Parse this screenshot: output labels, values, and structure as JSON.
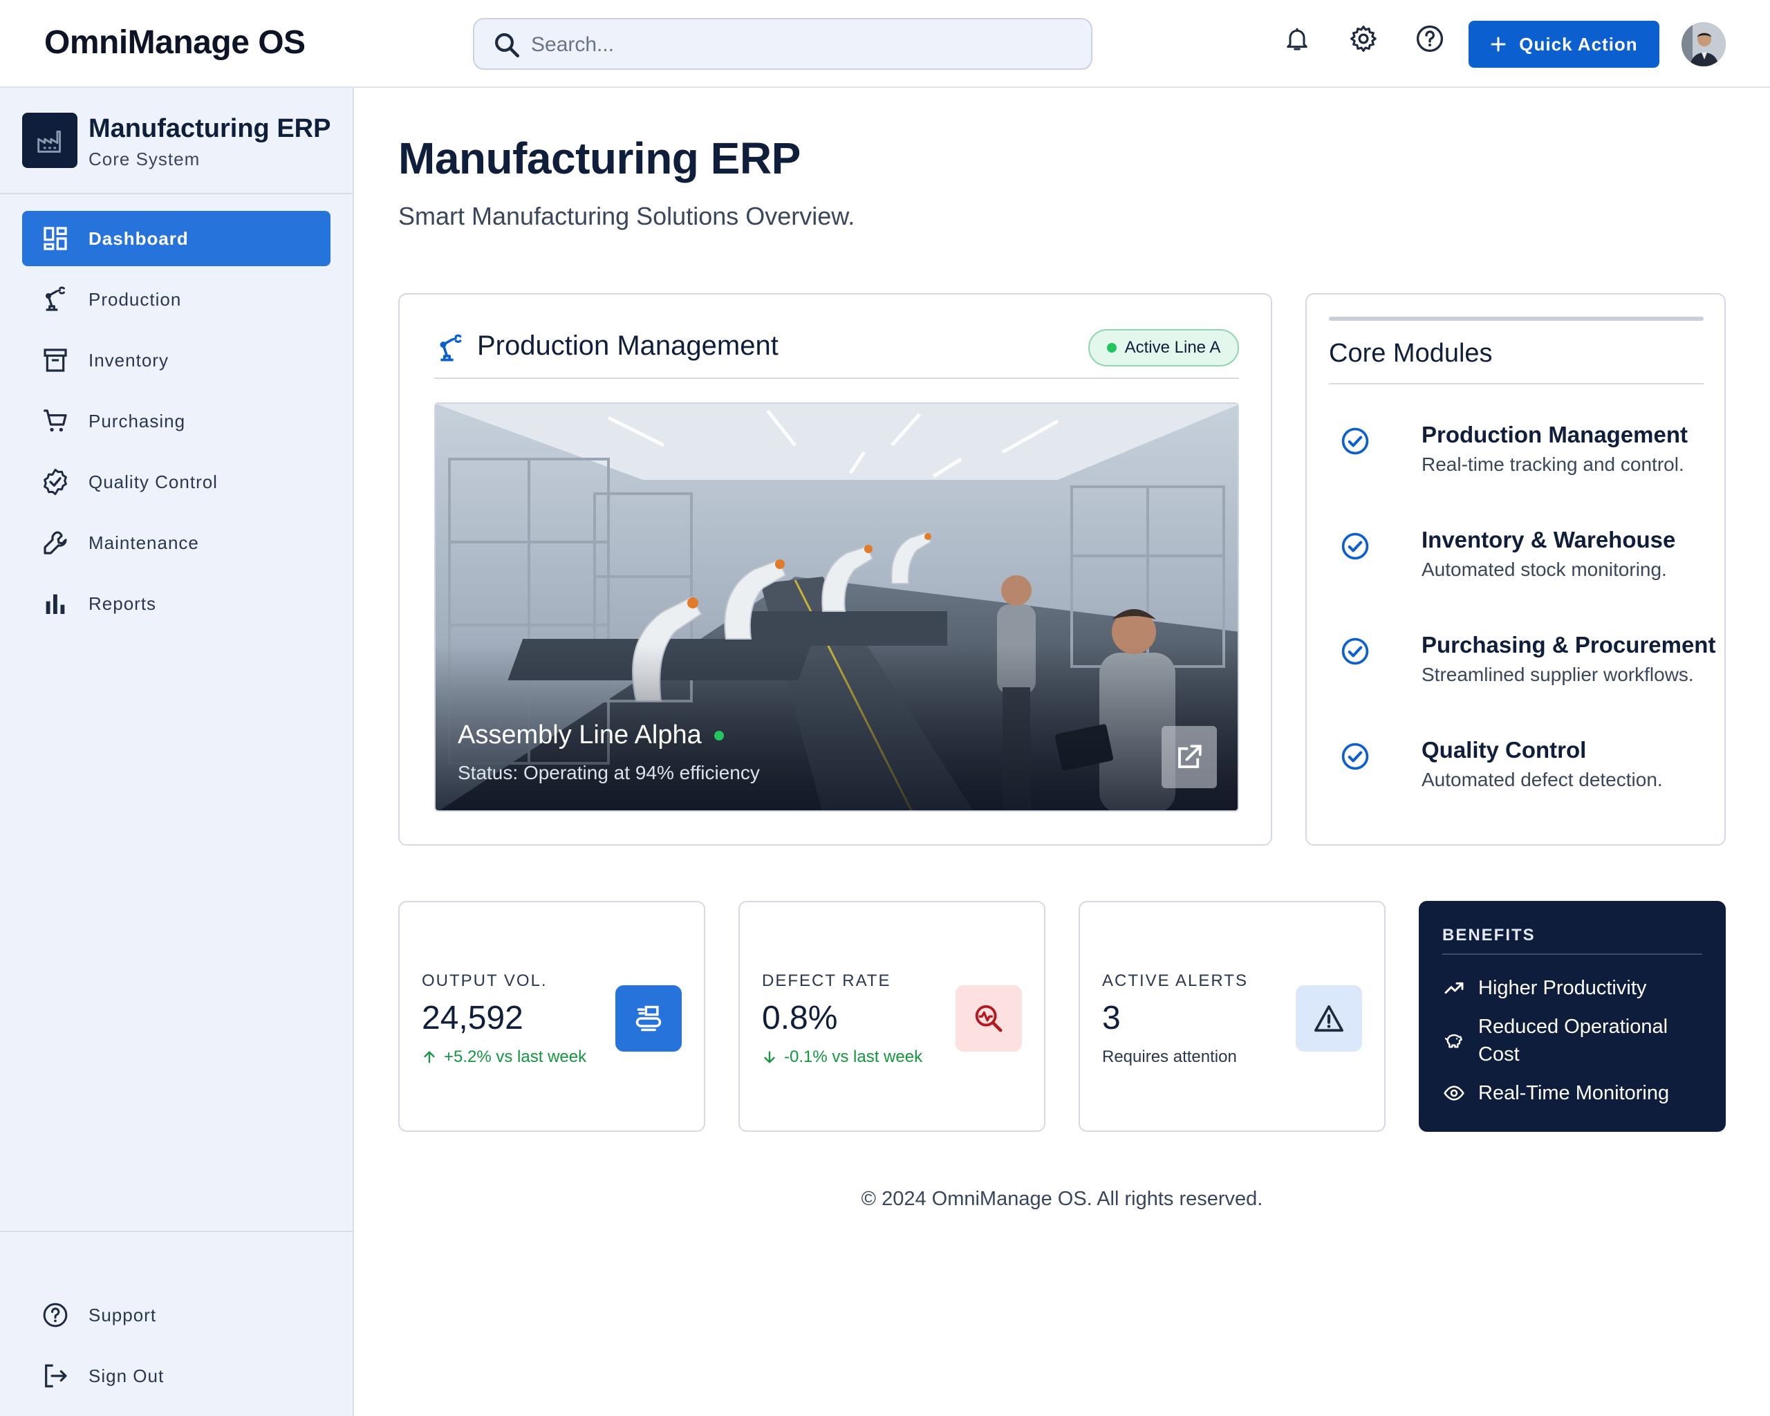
{
  "header": {
    "brand": "OmniManage OS",
    "search_placeholder": "Search...",
    "quick_action_label": "Quick Action"
  },
  "sidebar": {
    "title": "Manufacturing ERP",
    "subtitle": "Core System",
    "items": [
      {
        "label": "Dashboard",
        "icon": "dashboard-icon",
        "active": true
      },
      {
        "label": "Production",
        "icon": "robot-arm-icon"
      },
      {
        "label": "Inventory",
        "icon": "archive-box-icon"
      },
      {
        "label": "Purchasing",
        "icon": "cart-icon"
      },
      {
        "label": "Quality Control",
        "icon": "verified-badge-icon"
      },
      {
        "label": "Maintenance",
        "icon": "wrench-icon"
      },
      {
        "label": "Reports",
        "icon": "bar-chart-icon"
      }
    ],
    "footer": [
      {
        "label": "Support",
        "icon": "help-circle-icon"
      },
      {
        "label": "Sign Out",
        "icon": "logout-icon"
      }
    ]
  },
  "page": {
    "title": "Manufacturing ERP",
    "subtitle": "Smart Manufacturing Solutions Overview."
  },
  "production_card": {
    "title": "Production Management",
    "badge": "Active Line A",
    "line_name": "Assembly Line Alpha",
    "line_status": "Status: Operating at 94% efficiency"
  },
  "core_modules": {
    "title": "Core Modules",
    "items": [
      {
        "title": "Production Management",
        "desc": "Real-time tracking and control."
      },
      {
        "title": "Inventory & Warehouse",
        "desc": "Automated stock monitoring."
      },
      {
        "title": "Purchasing & Procurement",
        "desc": "Streamlined supplier workflows."
      },
      {
        "title": "Quality Control",
        "desc": "Automated defect detection."
      }
    ]
  },
  "stats": [
    {
      "label": "OUTPUT VOL.",
      "value": "24,592",
      "change": "+5.2% vs last week",
      "trend": "up",
      "icon": "conveyor-icon",
      "accent": "#2673db"
    },
    {
      "label": "DEFECT RATE",
      "value": "0.8%",
      "change": "-0.1% vs last week",
      "trend": "down",
      "icon": "search-pulse-icon",
      "accent": "#fde0e0"
    },
    {
      "label": "ACTIVE ALERTS",
      "value": "3",
      "note": "Requires attention",
      "icon": "warning-icon",
      "accent": "#dbe7fb"
    }
  ],
  "benefits": {
    "title": "BENEFITS",
    "items": [
      {
        "label": "Higher Productivity",
        "icon": "trending-up-icon"
      },
      {
        "label": "Reduced Operational Cost",
        "icon": "piggy-bank-icon"
      },
      {
        "label": "Real-Time Monitoring",
        "icon": "eye-icon"
      }
    ]
  },
  "footer": {
    "text": "© 2024 OmniManage OS. All rights reserved."
  },
  "colors": {
    "primary": "#0c5fcf",
    "nav_active": "#2673db",
    "navy": "#0f1d3d",
    "success": "#15963f"
  }
}
